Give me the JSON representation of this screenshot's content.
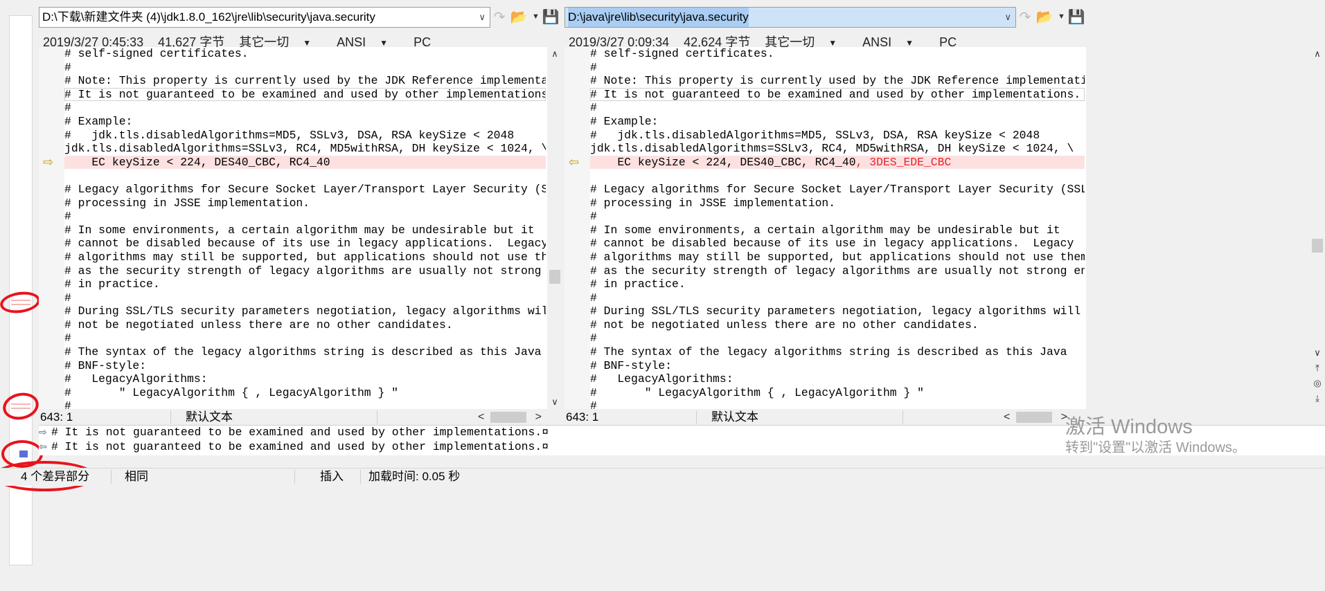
{
  "left_pane": {
    "path": "D:\\下载\\新建文件夹 (4)\\jdk1.8.0_162\\jre\\lib\\security\\java.security",
    "date": "2019/3/27 0:45:33",
    "size": "41,627 字节",
    "encoding_mode": "其它一切",
    "charset": "ANSI",
    "line_ending": "PC",
    "lines": [
      "# self-signed certificates.",
      "#",
      "# Note: This property is currently used by the JDK Reference implementation.",
      "# It is not guaranteed to be examined and used by other implementations.",
      "#",
      "# Example:",
      "#   jdk.tls.disabledAlgorithms=MD5, SSLv3, DSA, RSA keySize < 2048",
      "jdk.tls.disabledAlgorithms=SSLv3, RC4, MD5withRSA, DH keySize < 1024, \\",
      "    EC keySize < 224, DES40_CBC, RC4_40",
      "",
      "# Legacy algorithms for Secure Socket Layer/Transport Layer Security (SSL/TLS)",
      "# processing in JSSE implementation.",
      "#",
      "# In some environments, a certain algorithm may be undesirable but it",
      "# cannot be disabled because of its use in legacy applications.  Legacy",
      "# algorithms may still be supported, but applications should not use them",
      "# as the security strength of legacy algorithms are usually not strong enough",
      "# in practice.",
      "#",
      "# During SSL/TLS security parameters negotiation, legacy algorithms will",
      "# not be negotiated unless there are no other candidates.",
      "#",
      "# The syntax of the legacy algorithms string is described as this Java",
      "# BNF-style:",
      "#   LegacyAlgorithms:",
      "#       \" LegacyAlgorithm { , LegacyAlgorithm } \"",
      "#"
    ],
    "cursor": "643: 1",
    "text_type": "默认文本"
  },
  "right_pane": {
    "path": "D:\\java\\jre\\lib\\security\\java.security",
    "date": "2019/3/27 0:09:34",
    "size": "42,624 字节",
    "encoding_mode": "其它一切",
    "charset": "ANSI",
    "line_ending": "PC",
    "lines": [
      "# self-signed certificates.",
      "#",
      "# Note: This property is currently used by the JDK Reference implementation.",
      "# It is not guaranteed to be examined and used by other implementations.",
      "#",
      "# Example:",
      "#   jdk.tls.disabledAlgorithms=MD5, SSLv3, DSA, RSA keySize < 2048",
      "jdk.tls.disabledAlgorithms=SSLv3, RC4, MD5withRSA, DH keySize < 1024, \\",
      "    EC keySize < 224, DES40_CBC, RC4_40",
      "",
      "# Legacy algorithms for Secure Socket Layer/Transport Layer Security (SSL/TLS)",
      "# processing in JSSE implementation.",
      "#",
      "# In some environments, a certain algorithm may be undesirable but it",
      "# cannot be disabled because of its use in legacy applications.  Legacy",
      "# algorithms may still be supported, but applications should not use them",
      "# as the security strength of legacy algorithms are usually not strong enough",
      "# in practice.",
      "#",
      "# During SSL/TLS security parameters negotiation, legacy algorithms will",
      "# not be negotiated unless there are no other candidates.",
      "#",
      "# The syntax of the legacy algorithms string is described as this Java",
      "# BNF-style:",
      "#   LegacyAlgorithms:",
      "#       \" LegacyAlgorithm { , LegacyAlgorithm } \"",
      "#"
    ],
    "diff_added_text": ", 3DES_EDE_CBC",
    "cursor": "643: 1",
    "text_type": "默认文本"
  },
  "compare": {
    "line1": "# It is not guaranteed to be examined and used by other implementations.¤",
    "line2": "# It is not guaranteed to be examined and used by other implementations.¤"
  },
  "status": {
    "diff_count": "4 个差异部分",
    "same": "相同",
    "insert_mode": "插入",
    "load_time": "加载时间: 0.05 秒"
  },
  "watermark": {
    "title": "激活 Windows",
    "subtitle": "转到\"设置\"以激活 Windows。"
  },
  "colors": {
    "diff_bg": "#fde1e1",
    "diff_text": "#e6232a",
    "selection": "#a9cdf3",
    "annotation": "#e8141c"
  }
}
